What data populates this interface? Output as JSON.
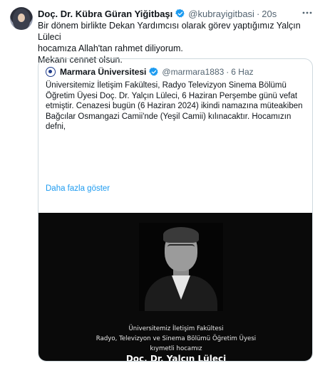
{
  "tweet": {
    "author_name": "Doç. Dr. Kübra Güran Yiğitbaşı",
    "handle": "@kubrayigitbasi",
    "dot": "·",
    "time": "20s",
    "more_icon": "more-horizontal-icon",
    "text_line1": "Bir dönem birlikte Dekan Yardımcısı olarak görev yaptığımız Yalçın Lüleci",
    "text_line2": "hocamıza Allah'tan rahmet diliyorum.",
    "text_line3": "Mekanı cennet olsun."
  },
  "quote": {
    "author_name": "Marmara Üniversitesi",
    "handle": "@marmara1883",
    "dot": "·",
    "time": "6 Haz",
    "text": "Üniversitemiz İletişim Fakültesi, Radyo Televizyon Sinema Bölümü Öğretim Üyesi Doç. Dr. Yalçın Lüleci, 6 Haziran Perşembe günü vefat etmiştir. Cenazesi bugün (6 Haziran 2024) ikindi namazına müteakiben Bağcılar Osmangazi Camii'nde (Yeşil Camii) kılınacaktır. Hocamızın defni,",
    "show_more": "Daha fazla göster",
    "image": {
      "line1": "Üniversitemiz İletişim Fakültesi",
      "line2": "Radyo, Televizyon ve Sinema Bölümü Öğretim Üyesi",
      "line3": "kıymetli hocamız",
      "line4": "Doç. Dr. Yalçın Lüleci"
    }
  },
  "colors": {
    "text": "#0f1419",
    "muted": "#536471",
    "link": "#1d9bf0",
    "verified": "#1d9bf0",
    "border": "#cfd9de"
  }
}
